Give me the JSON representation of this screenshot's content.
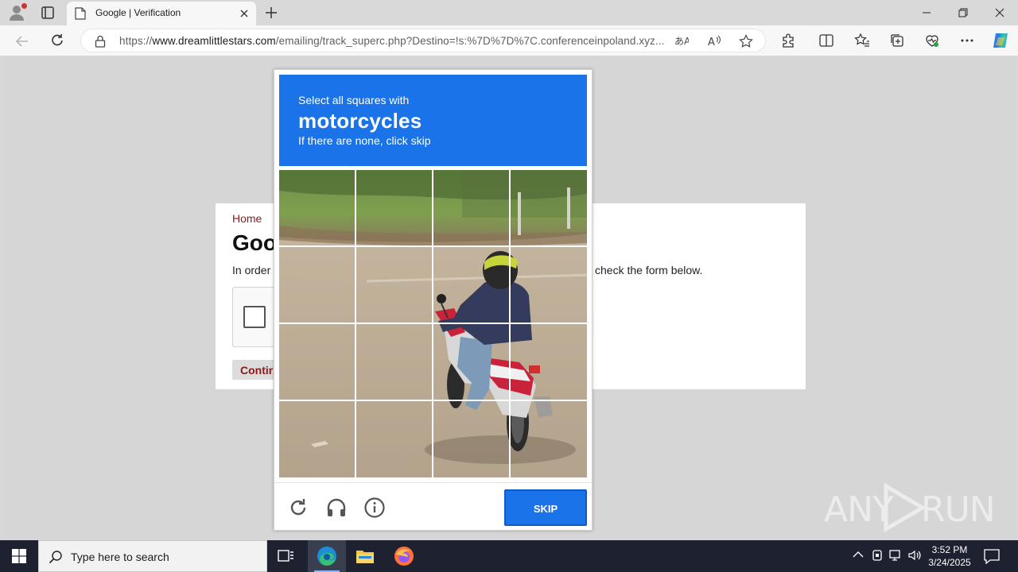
{
  "browser": {
    "tab_title": "Google | Verification",
    "url_prefix": "https://",
    "url_host": "www.dreamlittlestars.com",
    "url_rest": "/emailing/track_superc.php?Destino=!s:%7D%7D%7C.conferenceinpoland.xyz..."
  },
  "page": {
    "breadcrumb_home": "Home",
    "heading": "Goo",
    "lead": "In order",
    "lead_tail": "check the form below.",
    "continue_label": "Contir"
  },
  "captcha": {
    "instruction_line1": "Select all squares with",
    "target_object": "motorcycles",
    "instruction_line3": "If there are none, click skip",
    "skip_label": "SKIP",
    "grid_rows": 4,
    "grid_cols": 4,
    "footer_icons": [
      "reload-icon",
      "audio-headphones-icon",
      "info-icon"
    ],
    "accent_color": "#1a73e8"
  },
  "watermark": {
    "left": "ANY",
    "right": "RUN"
  },
  "taskbar": {
    "search_placeholder": "Type here to search",
    "time": "3:52 PM",
    "date": "3/24/2025",
    "apps": [
      "task-view-icon",
      "edge-icon",
      "file-explorer-icon",
      "firefox-icon"
    ]
  }
}
